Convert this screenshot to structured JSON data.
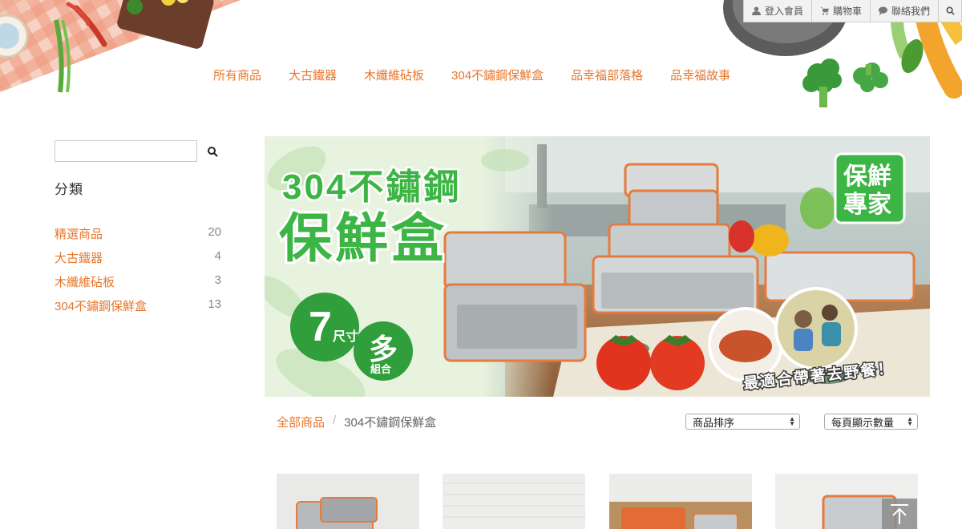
{
  "topbar": {
    "login_label": "登入會員",
    "cart_label": "購物車",
    "contact_label": "聯絡我們"
  },
  "nav": {
    "items": [
      "所有商品",
      "大古鐵器",
      "木纖維砧板",
      "304不鏽鋼保鮮盒",
      "品幸福部落格",
      "品幸福故事"
    ]
  },
  "sidebar": {
    "search_value": "",
    "category_title": "分類",
    "categories": [
      {
        "label": "精選商品",
        "count": "20"
      },
      {
        "label": "大古鐵器",
        "count": "4"
      },
      {
        "label": "木纖維砧板",
        "count": "3"
      },
      {
        "label": "304不鏽鋼保鮮盒",
        "count": "13"
      }
    ]
  },
  "banner": {
    "headline_1": "304不鏽鋼",
    "headline_2": "保鮮盒",
    "badge_1_big": "7",
    "badge_1_small": "尺寸",
    "badge_2_big": "多",
    "badge_2_small": "組合",
    "corner_badge_1": "保鮮",
    "corner_badge_2": "專家",
    "tagline": "最適合帶著去野餐！"
  },
  "breadcrumb": {
    "home": "全部商品",
    "separator": "/",
    "current": "304不鏽鋼保鮮盒"
  },
  "sort": {
    "sort_label": "商品排序",
    "per_page_label": "每頁顯示數量"
  },
  "colors": {
    "accent": "#e8762b",
    "brand_green": "#3cb544"
  }
}
